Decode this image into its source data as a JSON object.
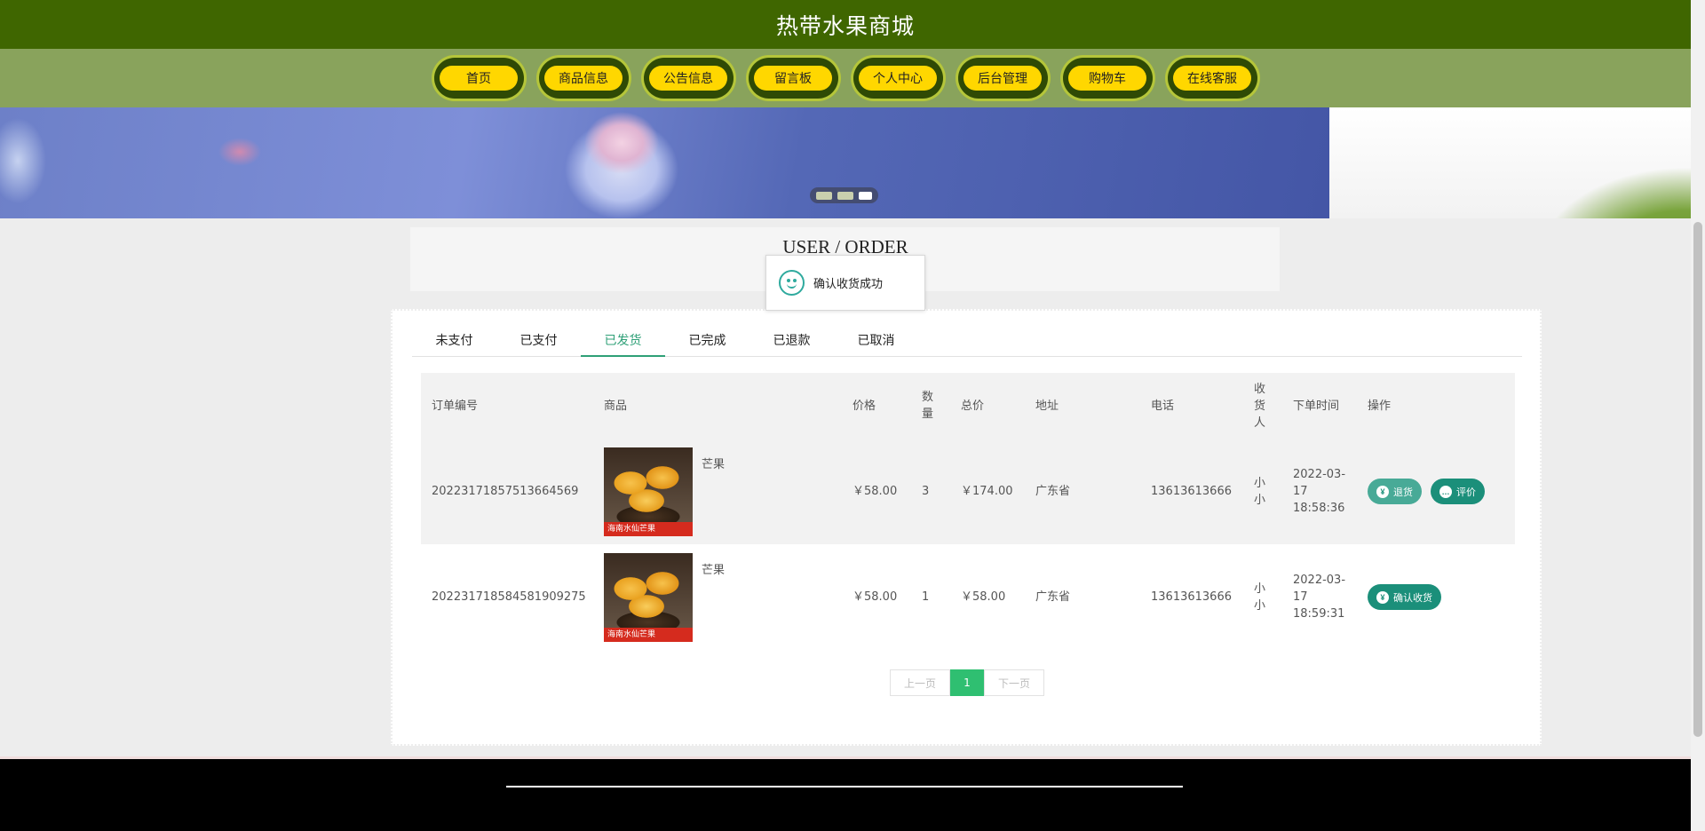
{
  "header": {
    "title": "热带水果商城"
  },
  "nav": [
    {
      "label": "首页"
    },
    {
      "label": "商品信息"
    },
    {
      "label": "公告信息"
    },
    {
      "label": "留言板"
    },
    {
      "label": "个人中心"
    },
    {
      "label": "后台管理"
    },
    {
      "label": "购物车"
    },
    {
      "label": "在线客服"
    }
  ],
  "banner": {
    "slide_count": 3,
    "active_index": 2
  },
  "page": {
    "title": "USER / ORDER"
  },
  "toast": {
    "message": "确认收货成功",
    "icon": "smile-icon"
  },
  "tabs": {
    "items": [
      {
        "label": "未支付"
      },
      {
        "label": "已支付"
      },
      {
        "label": "已发货"
      },
      {
        "label": "已完成"
      },
      {
        "label": "已退款"
      },
      {
        "label": "已取消"
      }
    ],
    "active": "已发货"
  },
  "table": {
    "headers": {
      "order_no": "订单编号",
      "product": "商品",
      "price": "价格",
      "qty": "数量",
      "total": "总价",
      "address": "地址",
      "phone": "电话",
      "receiver": "收货人",
      "order_time": "下单时间",
      "actions": "操作"
    },
    "rows": [
      {
        "order_no": "20223171857513664569",
        "product_name": "芒果",
        "product_image_text": "海南水仙芒果",
        "price": "￥58.00",
        "qty": "3",
        "total": "￥174.00",
        "address": "广东省",
        "phone": "13613613666",
        "receiver": "小小",
        "order_time": "2022-03-17 18:58:36",
        "actions": [
          {
            "label": "退货",
            "icon": "yen-icon"
          },
          {
            "label": "评价",
            "icon": "comment-icon"
          }
        ]
      },
      {
        "order_no": "20223171858458190927 5",
        "product_name": "芒果",
        "product_image_text": "海南水仙芒果",
        "price": "￥58.00",
        "qty": "1",
        "total": "￥58.00",
        "address": "广东省",
        "phone": "13613613666",
        "receiver": "小小",
        "order_time": "2022-03-17 18:59:31",
        "actions": [
          {
            "label": "确认收货",
            "icon": "yen-icon"
          }
        ]
      }
    ]
  },
  "pagination": {
    "prev_label": "上一页",
    "current": "1",
    "next_label": "下一页"
  },
  "colors": {
    "topbar": "#3f6600",
    "navbar": "#89a35c",
    "nav_pill": "#ffd700",
    "accent_green": "#2fa077",
    "button_teal": "#1b8f7a",
    "pager_active": "#2fbf71"
  }
}
